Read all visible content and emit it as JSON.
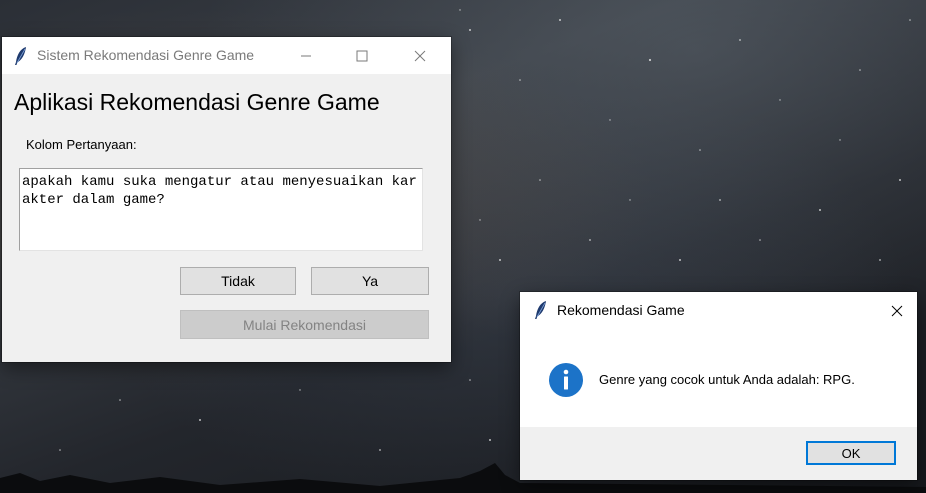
{
  "main_window": {
    "title": "Sistem Rekomendasi Genre Game",
    "heading": "Aplikasi Rekomendasi Genre Game",
    "question_label": "Kolom Pertanyaan:",
    "question_text": "apakah kamu suka mengatur atau menyesuaikan karakter dalam game?",
    "no_button": "Tidak",
    "yes_button": "Ya",
    "start_button": "Mulai Rekomendasi"
  },
  "message_box": {
    "title": "Rekomendasi Game",
    "message": "Genre yang cocok untuk Anda adalah: RPG.",
    "ok_button": "OK"
  },
  "colors": {
    "window_bg": "#f0f0f0",
    "button_bg": "#e1e1e1",
    "disabled_text": "#838383",
    "accent": "#0078d7",
    "info_icon": "#1c73c8"
  },
  "icons": [
    "feather-icon",
    "minimize-icon",
    "maximize-icon",
    "close-icon",
    "info-icon"
  ]
}
